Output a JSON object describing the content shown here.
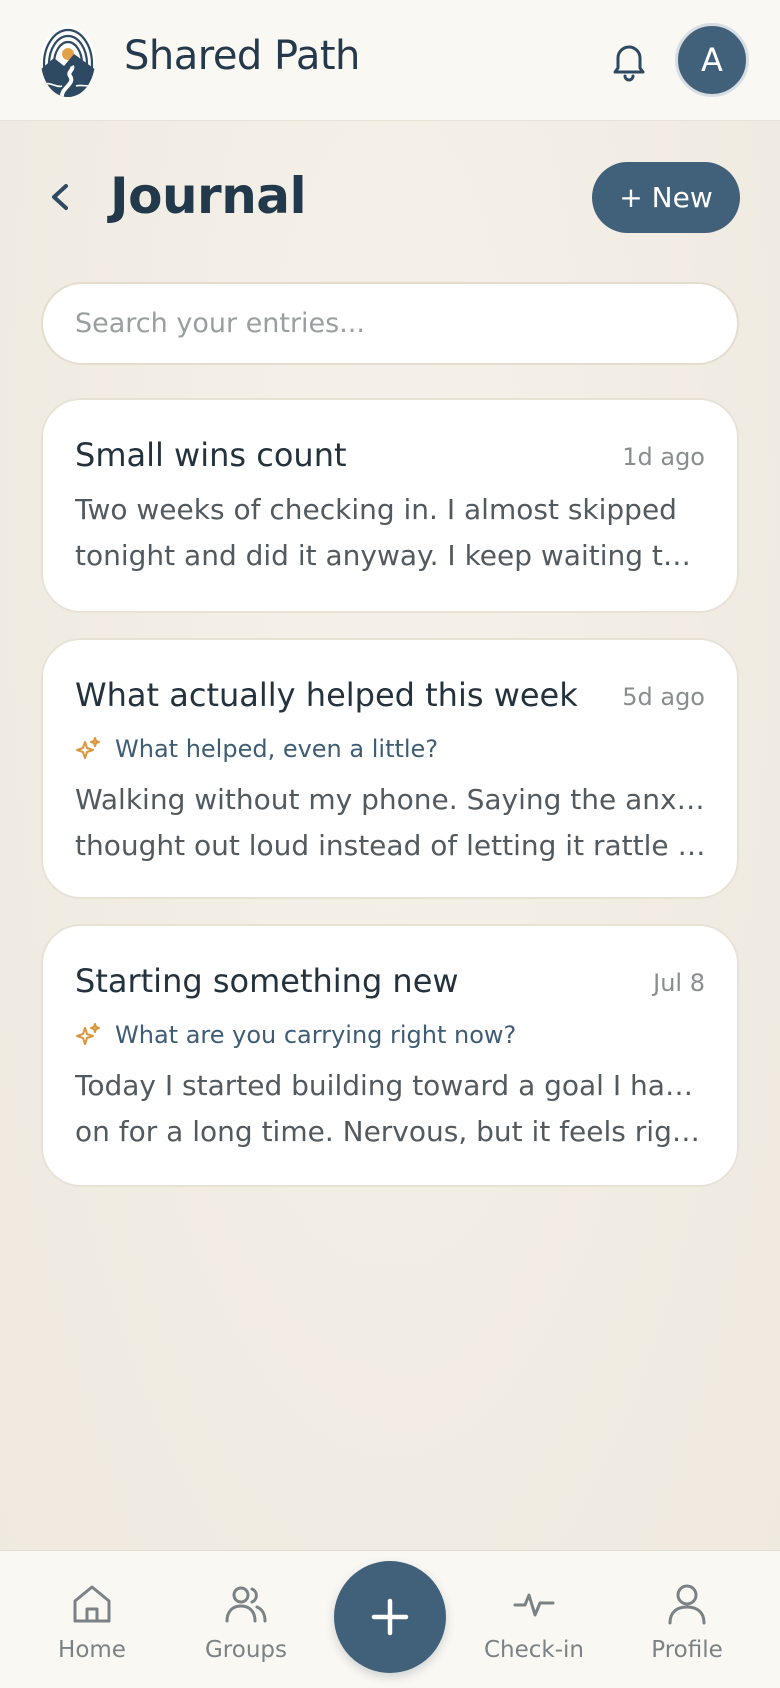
{
  "app": {
    "title": "Shared Path",
    "avatar_initial": "A"
  },
  "icons": {
    "logo": "shared-path-logo",
    "notifications": "bell-icon",
    "back": "chevron-left-icon",
    "prompt": "sparkle-icon"
  },
  "page": {
    "title": "Journal",
    "new_button": "+ New"
  },
  "search": {
    "placeholder": "Search your entries..."
  },
  "entries": [
    {
      "title": "Small wins count",
      "date": "1d ago",
      "prompt": "",
      "excerpt_line1": "Two weeks of checking in. I almost skipped",
      "excerpt_line2": "tonight and did it anyway. I keep waiting to feel..."
    },
    {
      "title": "What actually helped this week",
      "date": "5d ago",
      "prompt": "What helped, even a little?",
      "excerpt_line1": "Walking without my phone. Saying the anxious",
      "excerpt_line2": "thought out loud instead of letting it rattle aroun..."
    },
    {
      "title": "Starting something new",
      "date": "Jul 8",
      "prompt": "What are you carrying right now?",
      "excerpt_line1": "Today I started building toward a goal I have sat",
      "excerpt_line2": "on for a long time. Nervous, but it feels right...."
    }
  ],
  "nav": {
    "home": "Home",
    "groups": "Groups",
    "checkin": "Check-in",
    "profile": "Profile"
  },
  "colors": {
    "primary": "#41617a",
    "accent": "#d9963b",
    "background": "#f2ede4"
  }
}
